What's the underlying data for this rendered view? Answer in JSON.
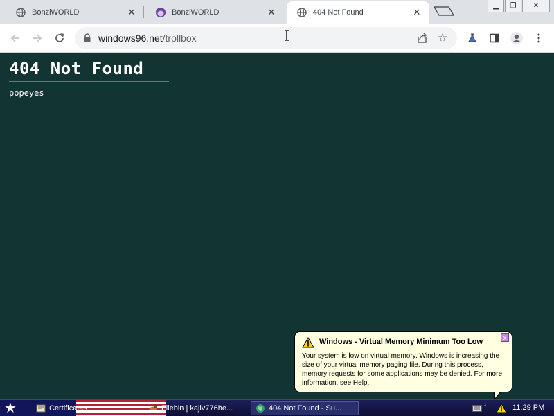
{
  "browser": {
    "tabs": [
      {
        "title": "BonziWORLD",
        "favicon": "globe-icon",
        "active": false
      },
      {
        "title": "BonziWORLD",
        "favicon": "bonzi-icon",
        "active": false
      },
      {
        "title": "404 Not Found",
        "favicon": "globe-icon",
        "active": true
      }
    ],
    "url": {
      "host": "windows96.net",
      "path": "/trollbox"
    }
  },
  "page": {
    "heading": "404 Not Found",
    "message": "popeyes"
  },
  "notification": {
    "title": "Windows - Virtual Memory Minimum Too Low",
    "body": "Your system is low on virtual memory. Windows is increasing the size of your virtual memory paging file. During this process, memory requests for some applications may be denied. For more information, see Help.",
    "close_label": "x"
  },
  "taskbar": {
    "tasks": [
      {
        "label": "Certificates"
      },
      {
        "label": "Filebin | kajiv776he..."
      },
      {
        "label": "404 Not Found - Su..."
      }
    ],
    "clock": "11:29 PM"
  },
  "colors": {
    "page_background": "#123432",
    "heading_rule": "#3f8a7c",
    "balloon_background": "#ffffe1"
  }
}
